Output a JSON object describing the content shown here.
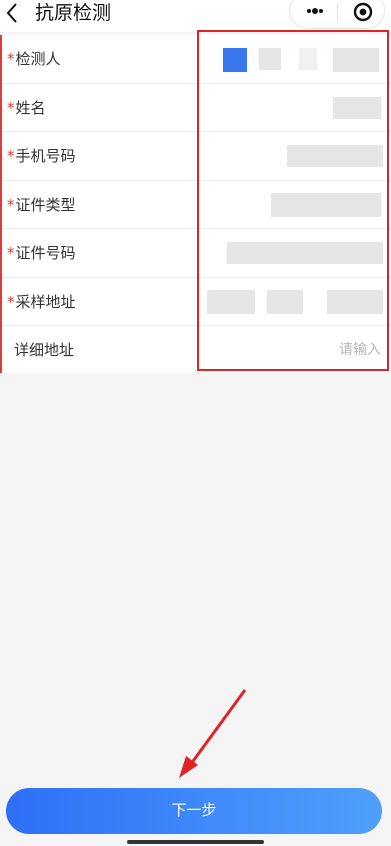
{
  "header": {
    "title": "抗原检测",
    "icons": {
      "back": "chevron-left-icon",
      "more": "more-dots-icon",
      "close": "target-icon"
    }
  },
  "form": {
    "required_mark": "*",
    "fields": [
      {
        "label": "检测人",
        "required": true
      },
      {
        "label": "姓名",
        "required": true
      },
      {
        "label": "手机号码",
        "required": true
      },
      {
        "label": "证件类型",
        "required": true
      },
      {
        "label": "证件号码",
        "required": true
      },
      {
        "label": "采样地址",
        "required": true
      },
      {
        "label": "详细地址",
        "required": false,
        "placeholder": "请输入"
      }
    ]
  },
  "footer": {
    "next_label": "下一步"
  },
  "colors": {
    "accent": "#2e6ff7",
    "annotation": "#e02424"
  }
}
